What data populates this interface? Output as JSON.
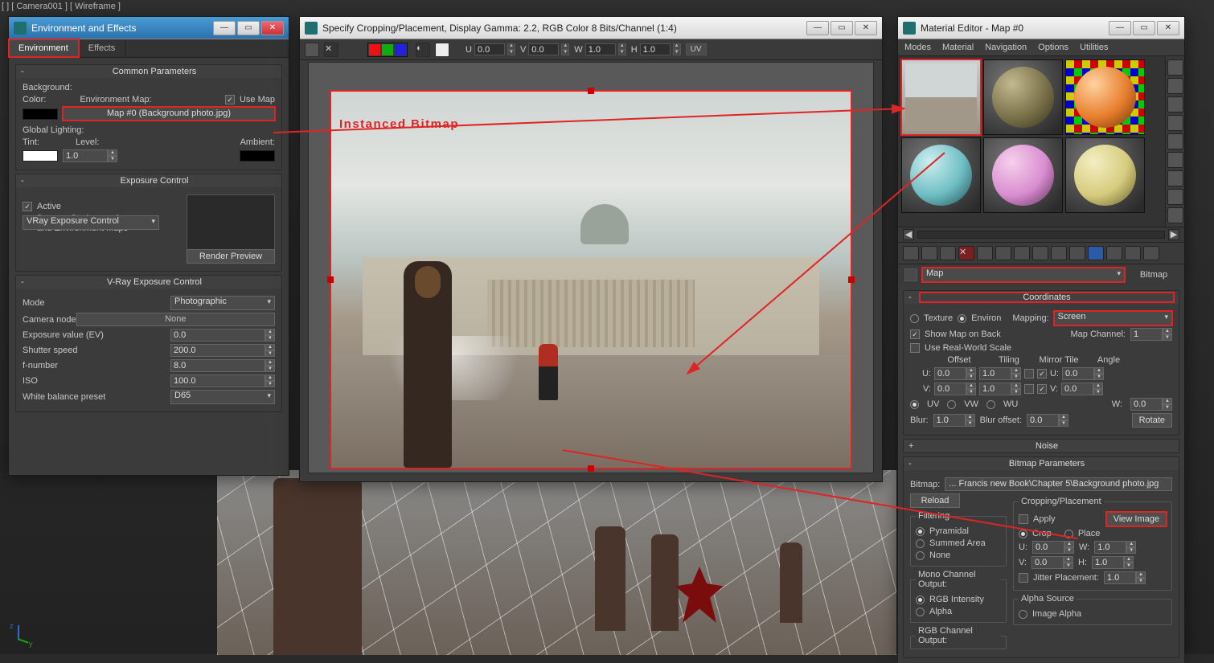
{
  "viewport_label": "[ ] [ Camera001 ] [ Wireframe ]",
  "env": {
    "title": "Environment and Effects",
    "tabs": {
      "environment": "Environment",
      "effects": "Effects"
    },
    "common": {
      "title": "Common Parameters",
      "background_label": "Background:",
      "color_label": "Color:",
      "envmap_label": "Environment Map:",
      "usemap_label": "Use Map",
      "usemap_checked": true,
      "map_button": "Map #0 (Background photo.jpg)",
      "global_label": "Global Lighting:",
      "tint_label": "Tint:",
      "level_label": "Level:",
      "level_value": "1.0",
      "ambient_label": "Ambient:"
    },
    "exposure": {
      "title": "Exposure Control",
      "dropdown": "VRay Exposure Control",
      "active_label": "Active",
      "active_checked": true,
      "process_label1": "Process Background",
      "process_label2": "and Environment Maps",
      "process_checked": true,
      "render_preview": "Render Preview"
    },
    "vray": {
      "title": "V-Ray Exposure Control",
      "mode_label": "Mode",
      "mode_value": "Photographic",
      "camera_label": "Camera node",
      "camera_value": "None",
      "ev_label": "Exposure value (EV)",
      "ev_value": "0.0",
      "shutter_label": "Shutter speed",
      "shutter_value": "200.0",
      "fnum_label": "f-number",
      "fnum_value": "8.0",
      "iso_label": "ISO",
      "iso_value": "100.0",
      "wb_label": "White balance preset",
      "wb_value": "D65"
    }
  },
  "crop": {
    "title": "Specify Cropping/Placement, Display Gamma: 2.2, RGB Color 8 Bits/Channel (1:4)",
    "uv_toggle": "UV",
    "u": {
      "l": "U",
      "v": "0.0"
    },
    "v": {
      "l": "V",
      "v": "0.0"
    },
    "w": {
      "l": "W",
      "v": "1.0"
    },
    "h": {
      "l": "H",
      "v": "1.0"
    },
    "instanced": "Instanced Bitmap"
  },
  "mat": {
    "title": "Material Editor - Map #0",
    "menus": {
      "modes": "Modes",
      "material": "Material",
      "navigation": "Navigation",
      "options": "Options",
      "utilities": "Utilities"
    },
    "slot_name": "Map",
    "map_type": "Bitmap",
    "coords": {
      "title": "Coordinates",
      "texture": "Texture",
      "environ": "Environ",
      "mapping_label": "Mapping:",
      "mapping_value": "Screen",
      "showmap_label": "Show Map on Back",
      "showmap_checked": true,
      "mapchannel_label": "Map Channel:",
      "mapchannel_value": "1",
      "realworld_label": "Use Real-World Scale",
      "realworld_checked": false,
      "hdr": {
        "offset": "Offset",
        "tiling": "Tiling",
        "mirrortile": "Mirror Tile",
        "angle": "Angle"
      },
      "u": {
        "lbl": "U:",
        "offset": "0.0",
        "tiling": "1.0",
        "mirror": false,
        "tile": true,
        "angle_lbl": "U:",
        "angle": "0.0"
      },
      "v": {
        "lbl": "V:",
        "offset": "0.0",
        "tiling": "1.0",
        "mirror": false,
        "tile": true,
        "angle_lbl": "V:",
        "angle": "0.0"
      },
      "w_angle": {
        "lbl": "W:",
        "angle": "0.0"
      },
      "uvw_mode": {
        "uv": "UV",
        "vw": "VW",
        "wu": "WU",
        "selected": "UV"
      },
      "blur_label": "Blur:",
      "blur_value": "1.0",
      "bluroff_label": "Blur offset:",
      "bluroff_value": "0.0",
      "rotate": "Rotate"
    },
    "noise": {
      "title": "Noise"
    },
    "bmp": {
      "title": "Bitmap Parameters",
      "bitmap_label": "Bitmap:",
      "bitmap_path": "... Francis new Book\\Chapter 5\\Background photo.jpg",
      "reload": "Reload",
      "cropplace": "Cropping/Placement",
      "apply": "Apply",
      "apply_checked": false,
      "viewimage": "View Image",
      "crop": "Crop",
      "place": "Place",
      "u": "U:",
      "u_v": "0.0",
      "w": "W:",
      "w_v": "1.0",
      "v": "V:",
      "v_v": "0.0",
      "h": "H:",
      "h_v": "1.0",
      "jitter": "Jitter Placement:",
      "jitter_v": "1.0",
      "jitter_checked": false,
      "filtering": "Filtering",
      "pyr": "Pyramidal",
      "sa": "Summed Area",
      "none": "None",
      "mono": "Mono Channel Output:",
      "rgbi": "RGB Intensity",
      "alpha": "Alpha",
      "rgbco": "RGB Channel Output:",
      "alphasrc": "Alpha Source",
      "imgalpha": "Image Alpha"
    }
  }
}
